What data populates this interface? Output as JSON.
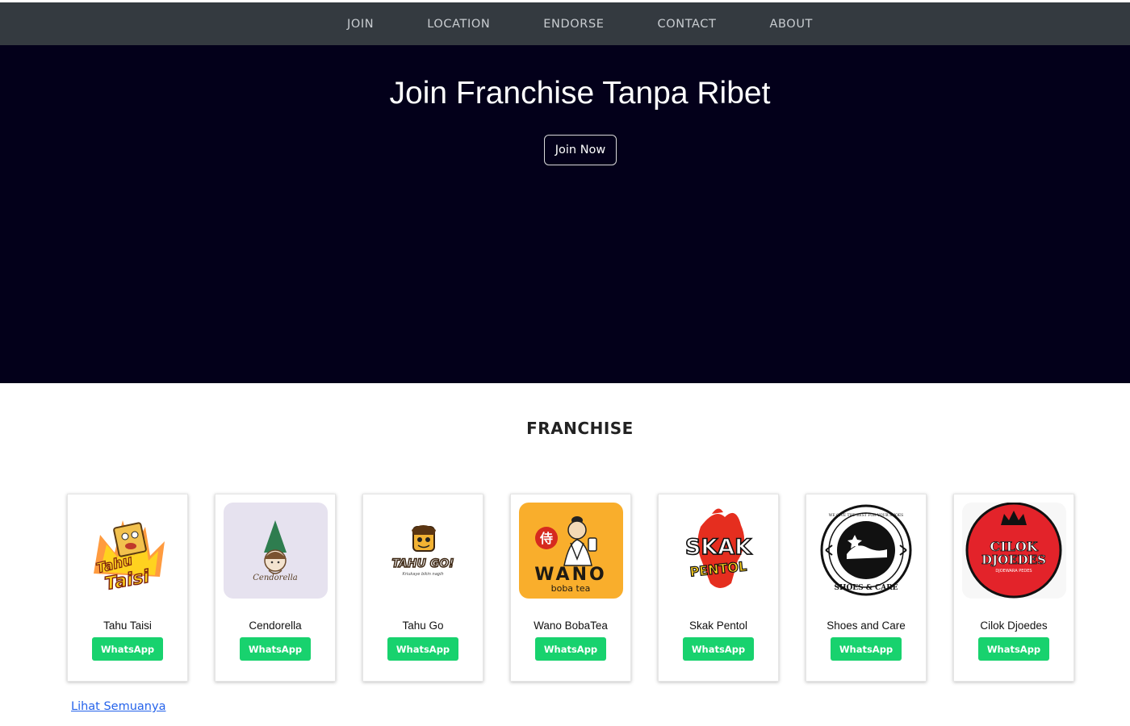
{
  "nav": {
    "items": [
      {
        "label": "JOIN"
      },
      {
        "label": "LOCATION"
      },
      {
        "label": "ENDORSE"
      },
      {
        "label": "CONTACT"
      },
      {
        "label": "ABOUT"
      }
    ]
  },
  "hero": {
    "title": "Join Franchise Tanpa Ribet",
    "button_label": "Join Now"
  },
  "franchise": {
    "section_title": "FRANCHISE",
    "cards": [
      {
        "name": "Tahu Taisi",
        "button": "WhatsApp",
        "logo_text": [
          "Tahu",
          "Taisi"
        ]
      },
      {
        "name": "Cendorella",
        "button": "WhatsApp",
        "logo_text": [
          "Cendorella"
        ]
      },
      {
        "name": "Tahu Go",
        "button": "WhatsApp",
        "logo_text": [
          "TAHU GO!",
          "Kriukaye bikin nagih"
        ]
      },
      {
        "name": "Wano BobaTea",
        "button": "WhatsApp",
        "logo_text": [
          "侍",
          "WANO",
          "boba tea"
        ]
      },
      {
        "name": "Skak Pentol",
        "button": "WhatsApp",
        "logo_text": [
          "SKAK",
          "PENTOL"
        ]
      },
      {
        "name": "Shoes and Care",
        "button": "WhatsApp",
        "logo_text": [
          "SHOES & CARE",
          "WE GIVE THE BEST FOR YOUR SHOES"
        ]
      },
      {
        "name": "Cilok Djoedes",
        "button": "WhatsApp",
        "logo_text": [
          "CILOK",
          "DJOEDES",
          "DJOEWARA PEDES"
        ]
      }
    ],
    "see_all": "Lihat Semuanya"
  },
  "colors": {
    "navbar": "#343a40",
    "hero_bg": "#03001a",
    "whatsapp": "#18d26e",
    "link": "#2563eb"
  }
}
